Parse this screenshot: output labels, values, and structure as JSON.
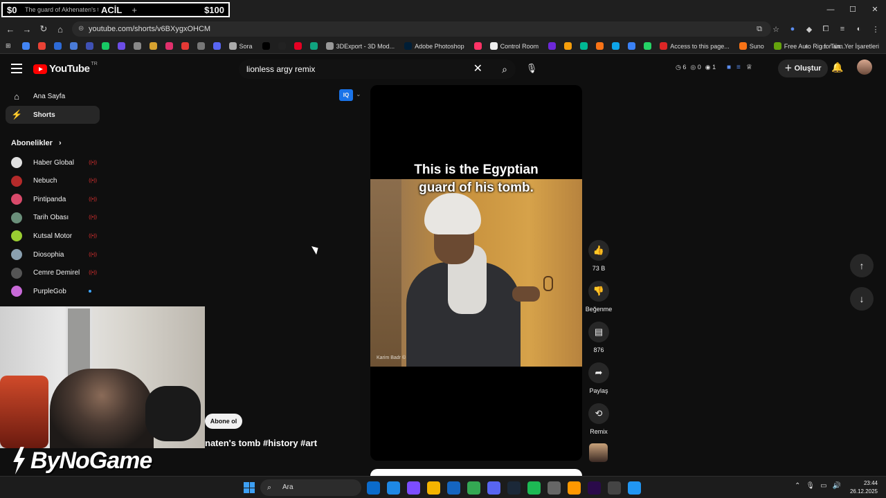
{
  "overlay": {
    "left_amount": "$0",
    "tab_title": "The guard of Akhenaten's t",
    "acil": "ACİL",
    "plus": "+",
    "right_amount": "$100"
  },
  "window": {
    "minimize": "—",
    "maximize": "☐",
    "close": "✕"
  },
  "browser": {
    "url": "youtube.com/shorts/v6BXygxOHCM",
    "bookmarks": [
      {
        "label": "",
        "color": "#4285f4"
      },
      {
        "label": "",
        "color": "#e94235"
      },
      {
        "label": "",
        "color": "#2d6ad6"
      },
      {
        "label": "",
        "color": "#4a7bd8"
      },
      {
        "label": "",
        "color": "#3f51b5"
      },
      {
        "label": "",
        "color": "#17c964"
      },
      {
        "label": "",
        "color": "#6c4de6"
      },
      {
        "label": "",
        "color": "#888888"
      },
      {
        "label": "",
        "color": "#d6a12f"
      },
      {
        "label": "",
        "color": "#e1306c"
      },
      {
        "label": "",
        "color": "#e53935"
      },
      {
        "label": "",
        "color": "#777777"
      },
      {
        "label": "",
        "color": "#5865f2"
      },
      {
        "label": "Sora",
        "color": "#aaaaaa"
      },
      {
        "label": "",
        "color": "#000000"
      },
      {
        "label": "",
        "color": "#222222"
      },
      {
        "label": "",
        "color": "#e60023"
      },
      {
        "label": "",
        "color": "#10a37f"
      },
      {
        "label": "3DExport - 3D Mod...",
        "color": "#999999"
      },
      {
        "label": "Adobe Photoshop",
        "color": "#001e36"
      },
      {
        "label": "",
        "color": "#ff3366"
      },
      {
        "label": "Control Room",
        "color": "#eeeeee"
      },
      {
        "label": "",
        "color": "#6d28d9"
      },
      {
        "label": "",
        "color": "#f59e0b"
      },
      {
        "label": "",
        "color": "#00b894"
      },
      {
        "label": "",
        "color": "#f97316"
      },
      {
        "label": "",
        "color": "#0ea5e9"
      },
      {
        "label": "",
        "color": "#3b82f6"
      },
      {
        "label": "",
        "color": "#25d366"
      },
      {
        "label": "Access to this page...",
        "color": "#dc2626"
      },
      {
        "label": "Suno",
        "color": "#f97316"
      },
      {
        "label": "Free Auto Rig for an...",
        "color": "#65a30d"
      }
    ],
    "all_bookmarks": "Tüm Yer İşaretleri"
  },
  "youtube": {
    "logo": "YouTube",
    "country": "TR",
    "search_query": "lionless argy remix",
    "header_stats": [
      "6",
      "0",
      "1"
    ],
    "create_label": "Oluştur",
    "nav": [
      {
        "label": "Ana Sayfa",
        "icon": "⌂"
      },
      {
        "label": "Shorts",
        "icon": "⚡"
      }
    ],
    "subscriptions_label": "Abonelikler",
    "subscriptions": [
      {
        "name": "Haber Global",
        "color": "#e0e0e0",
        "status": "live"
      },
      {
        "name": "Nebuch",
        "color": "#b42a2a",
        "status": "live"
      },
      {
        "name": "Pintipanda",
        "color": "#d84a6a",
        "status": "live"
      },
      {
        "name": "Tarih Obası",
        "color": "#6a8f7a",
        "status": "live"
      },
      {
        "name": "Kutsal Motor",
        "color": "#9acd32",
        "status": "live"
      },
      {
        "name": "Diosophia",
        "color": "#8aa0b0",
        "status": "live"
      },
      {
        "name": "Cemre Demirel",
        "color": "#555555",
        "status": "live"
      },
      {
        "name": "PurpleGob",
        "color": "#c86ad8",
        "status": "new"
      }
    ],
    "subscribe_label": "Abone ol",
    "video_title_partial": "naten's tomb #history #art",
    "short": {
      "caption_line1": "This is the Egyptian",
      "caption_line2": "guard of his tomb.",
      "photo_credit": "Karim Badr ©"
    },
    "actions": {
      "like_count": "73 B",
      "dislike_label": "Beğenme",
      "comment_count": "876",
      "share_label": "Paylaş",
      "remix_label": "Remix"
    }
  },
  "stream": {
    "brand": "ByNoGame"
  },
  "taskbar": {
    "search_label": "Ara",
    "apps": [
      "#0b6bcb",
      "#1e88e5",
      "#7c4dff",
      "#f4b400",
      "#1565c0",
      "#34a853",
      "#5865f2",
      "#1b2838",
      "#1db954",
      "#666666",
      "#ff9800",
      "#2a0a4a",
      "#444444",
      "#2196f3"
    ],
    "time": "23:44",
    "date": "26.12.2025"
  }
}
